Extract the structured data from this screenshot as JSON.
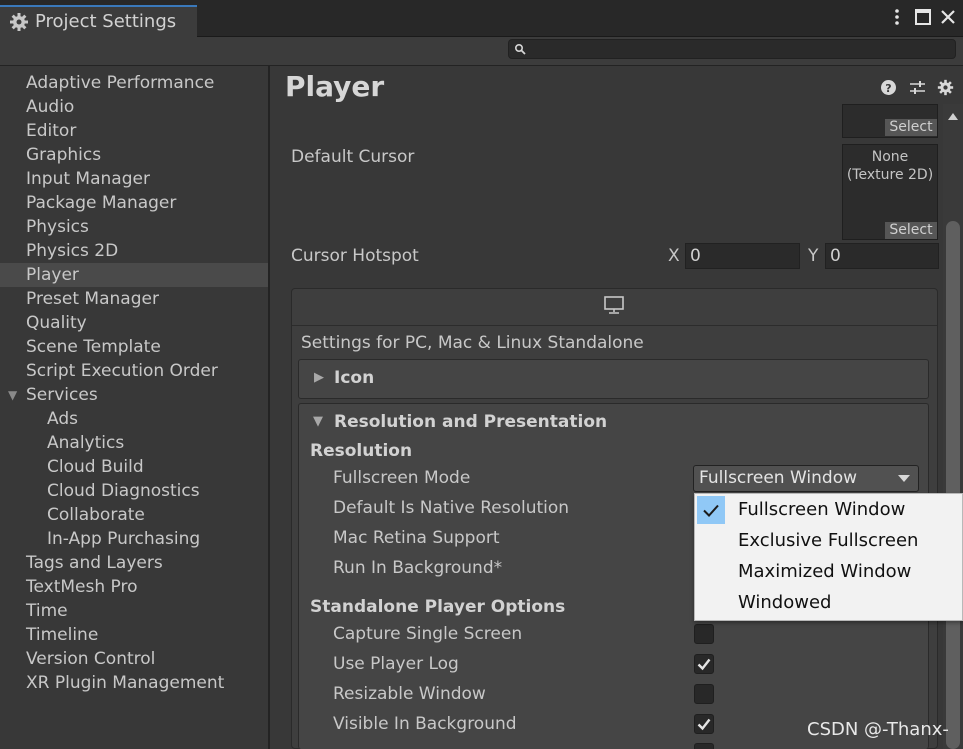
{
  "window": {
    "title": "Project Settings"
  },
  "search": {
    "placeholder": ""
  },
  "sidebar": {
    "items": [
      {
        "label": "Adaptive Performance"
      },
      {
        "label": "Audio"
      },
      {
        "label": "Editor"
      },
      {
        "label": "Graphics"
      },
      {
        "label": "Input Manager"
      },
      {
        "label": "Package Manager"
      },
      {
        "label": "Physics"
      },
      {
        "label": "Physics 2D"
      },
      {
        "label": "Player",
        "selected": true
      },
      {
        "label": "Preset Manager"
      },
      {
        "label": "Quality"
      },
      {
        "label": "Scene Template"
      },
      {
        "label": "Script Execution Order"
      },
      {
        "label": "Services",
        "expanded": true
      },
      {
        "label": "Ads"
      },
      {
        "label": "Analytics"
      },
      {
        "label": "Cloud Build"
      },
      {
        "label": "Cloud Diagnostics"
      },
      {
        "label": "Collaborate"
      },
      {
        "label": "In-App Purchasing"
      },
      {
        "label": "Tags and Layers"
      },
      {
        "label": "TextMesh Pro"
      },
      {
        "label": "Time"
      },
      {
        "label": "Timeline"
      },
      {
        "label": "Version Control"
      },
      {
        "label": "XR Plugin Management"
      }
    ]
  },
  "main": {
    "title": "Player",
    "icons": [
      "help-icon",
      "preset-icon",
      "gear-icon"
    ],
    "default_icon_select": "Select",
    "default_cursor": {
      "label": "Default Cursor",
      "value": "None\n(Texture 2D)",
      "select": "Select"
    },
    "cursor_hotspot": {
      "label": "Cursor Hotspot",
      "x_label": "X",
      "x_value": "0",
      "y_label": "Y",
      "y_value": "0"
    },
    "platform": {
      "icon": "monitor-icon",
      "settings_label": "Settings for PC, Mac & Linux Standalone",
      "icon_section": "Icon",
      "resolution_section": {
        "title": "Resolution and Presentation",
        "resolution_header": "Resolution",
        "fullscreen_mode": {
          "label": "Fullscreen Mode",
          "value": "Fullscreen Window"
        },
        "default_native": "Default Is Native Resolution",
        "mac_retina": "Mac Retina Support",
        "run_in_background": "Run In Background*",
        "standalone_header": "Standalone Player Options",
        "options": [
          {
            "label": "Capture Single Screen",
            "checked": false
          },
          {
            "label": "Use Player Log",
            "checked": true
          },
          {
            "label": "Resizable Window",
            "checked": false
          },
          {
            "label": "Visible In Background",
            "checked": true
          }
        ]
      }
    }
  },
  "menu": {
    "items": [
      {
        "label": "Fullscreen Window",
        "checked": true
      },
      {
        "label": "Exclusive Fullscreen",
        "checked": false
      },
      {
        "label": "Maximized Window",
        "checked": false
      },
      {
        "label": "Windowed",
        "checked": false
      }
    ]
  },
  "watermark": "CSDN @-Thanx-",
  "colors": {
    "background": "#383838",
    "selected": "#4a4a4a",
    "accent": "#3a79bb",
    "menu_check": "#90c8f6"
  }
}
